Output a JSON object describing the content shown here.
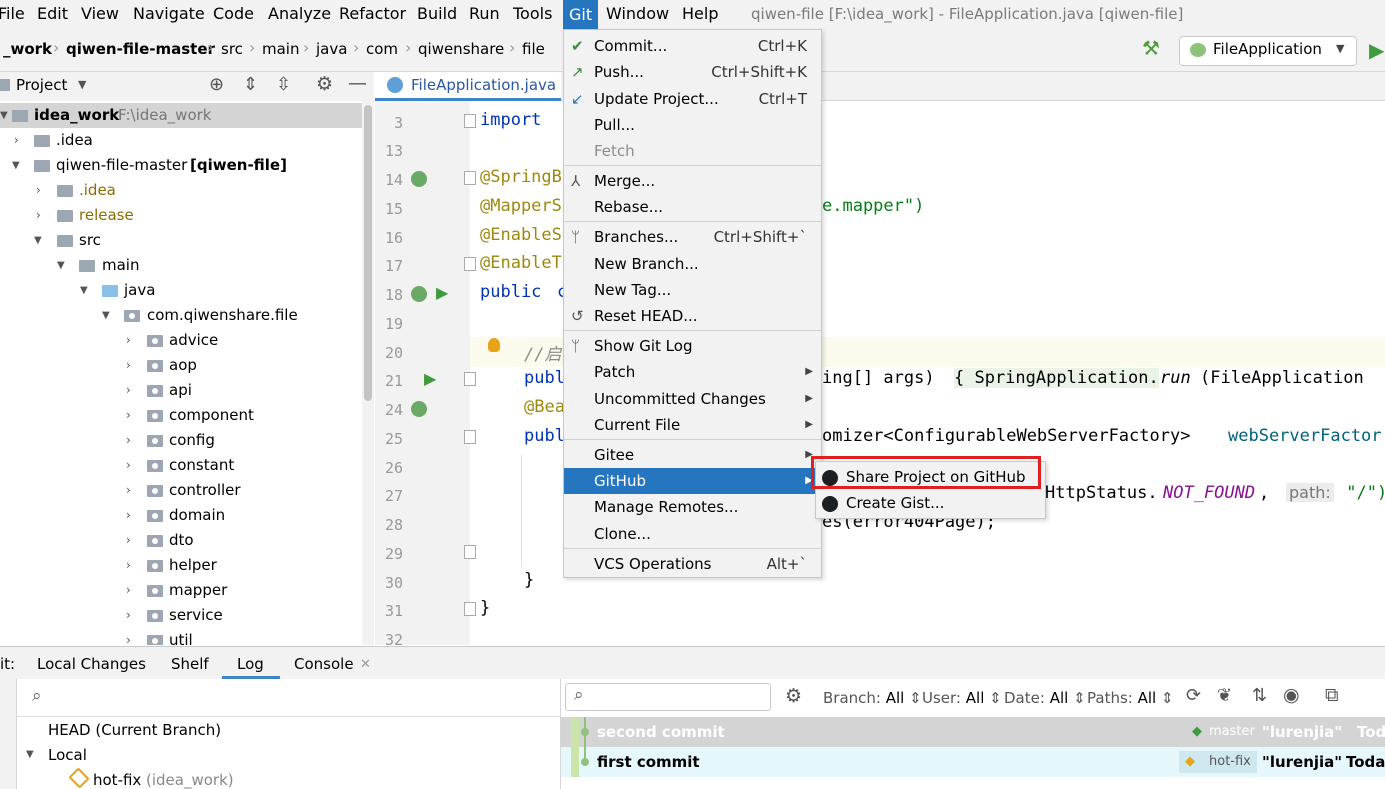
{
  "menubar": {
    "items": [
      "File",
      "Edit",
      "View",
      "Navigate",
      "Code",
      "Analyze",
      "Refactor",
      "Build",
      "Run",
      "Tools",
      "Git",
      "Window",
      "Help"
    ],
    "title": "qiwen-file [F:\\idea_work] - FileApplication.java [qiwen-file]"
  },
  "breadcrumb": [
    "_work",
    "qiwen-file-master",
    "src",
    "main",
    "java",
    "com",
    "qiwenshare",
    "file"
  ],
  "toolbar": {
    "run_config": "FileApplication"
  },
  "project_panel": {
    "title": "Project",
    "tree": [
      {
        "label": "idea_work",
        "hint": "F:\\idea_work"
      },
      {
        "label": ".idea"
      },
      {
        "label": "qiwen-file-master",
        "hint": "[qiwen-file]"
      },
      {
        "label": ".idea"
      },
      {
        "label": "release"
      },
      {
        "label": "src"
      },
      {
        "label": "main"
      },
      {
        "label": "java"
      },
      {
        "label": "com.qiwenshare.file"
      },
      {
        "label": "advice"
      },
      {
        "label": "aop"
      },
      {
        "label": "api"
      },
      {
        "label": "component"
      },
      {
        "label": "config"
      },
      {
        "label": "constant"
      },
      {
        "label": "controller"
      },
      {
        "label": "domain"
      },
      {
        "label": "dto"
      },
      {
        "label": "helper"
      },
      {
        "label": "mapper"
      },
      {
        "label": "service"
      },
      {
        "label": "util"
      }
    ]
  },
  "editor": {
    "tab": "FileApplication.java",
    "line_numbers": [
      "3",
      "13",
      "14",
      "15",
      "16",
      "17",
      "18",
      "19",
      "20",
      "21",
      "24",
      "25",
      "26",
      "27",
      "28",
      "29",
      "30",
      "31",
      "32"
    ],
    "code": {
      "l3_kw": "import",
      "l14": "@SpringB",
      "l15a": "@MapperS",
      "l15b": "e.mapper\")",
      "l16": "@EnableS",
      "l17": "@EnableT",
      "l18a": "public",
      "l18b": "c",
      "l20": "//启",
      "l21a": "publ",
      "l21b": "ing[] args) ",
      "l21c": "{ SpringApplication.",
      "l21d": "run",
      "l21e": "(FileApplication",
      "l24": "@Bea",
      "l25a": "publ",
      "l25b": "omizer<ConfigurableWebServerFactory> ",
      "l25c": "webServerFactor",
      "l27a": "HttpStatus.",
      "l27b": "NOT_FOUND",
      "l27c": ",  ",
      "l27d": "path:",
      "l27e": " \"/\")",
      "l28": "es(error404Page);",
      "l30": "}",
      "l31": "}"
    }
  },
  "git_menu": {
    "items": [
      {
        "label": "Commit...",
        "shortcut": "Ctrl+K"
      },
      {
        "label": "Push...",
        "shortcut": "Ctrl+Shift+K"
      },
      {
        "label": "Update Project...",
        "shortcut": "Ctrl+T"
      },
      {
        "label": "Pull..."
      },
      {
        "label": "Fetch"
      },
      {
        "label": "Merge..."
      },
      {
        "label": "Rebase..."
      },
      {
        "label": "Branches...",
        "shortcut": "Ctrl+Shift+`"
      },
      {
        "label": "New Branch..."
      },
      {
        "label": "New Tag..."
      },
      {
        "label": "Reset HEAD..."
      },
      {
        "label": "Show Git Log"
      },
      {
        "label": "Patch"
      },
      {
        "label": "Uncommitted Changes"
      },
      {
        "label": "Current File"
      },
      {
        "label": "Gitee"
      },
      {
        "label": "GitHub"
      },
      {
        "label": "Manage Remotes..."
      },
      {
        "label": "Clone..."
      },
      {
        "label": "VCS Operations",
        "shortcut": "Alt+`"
      }
    ]
  },
  "github_submenu": {
    "items": [
      "Share Project on GitHub",
      "Create Gist..."
    ]
  },
  "bottom_panel": {
    "prefix": "it:",
    "tabs": [
      "Local Changes",
      "Shelf",
      "Log",
      "Console"
    ],
    "branches": {
      "head": "HEAD (Current Branch)",
      "local": "Local",
      "branch": "hot-fix",
      "branch_hint": "(idea_work)"
    },
    "filters": {
      "branch": "Branch:",
      "branch_val": "All",
      "user": "User:",
      "user_val": "All",
      "date": "Date:",
      "date_val": "All",
      "paths": "Paths:",
      "paths_val": "All"
    },
    "commits": [
      {
        "message": "second commit",
        "tag": "master",
        "author": "\"lurenjia\"",
        "date": "Toda"
      },
      {
        "message": "first commit",
        "tag": "hot-fix",
        "author": "\"lurenjia\"",
        "date": "Toda"
      }
    ]
  },
  "colors": {
    "accent": "#2675bf",
    "highlight_box": "#e02020",
    "selection": "#d4d4d4"
  }
}
